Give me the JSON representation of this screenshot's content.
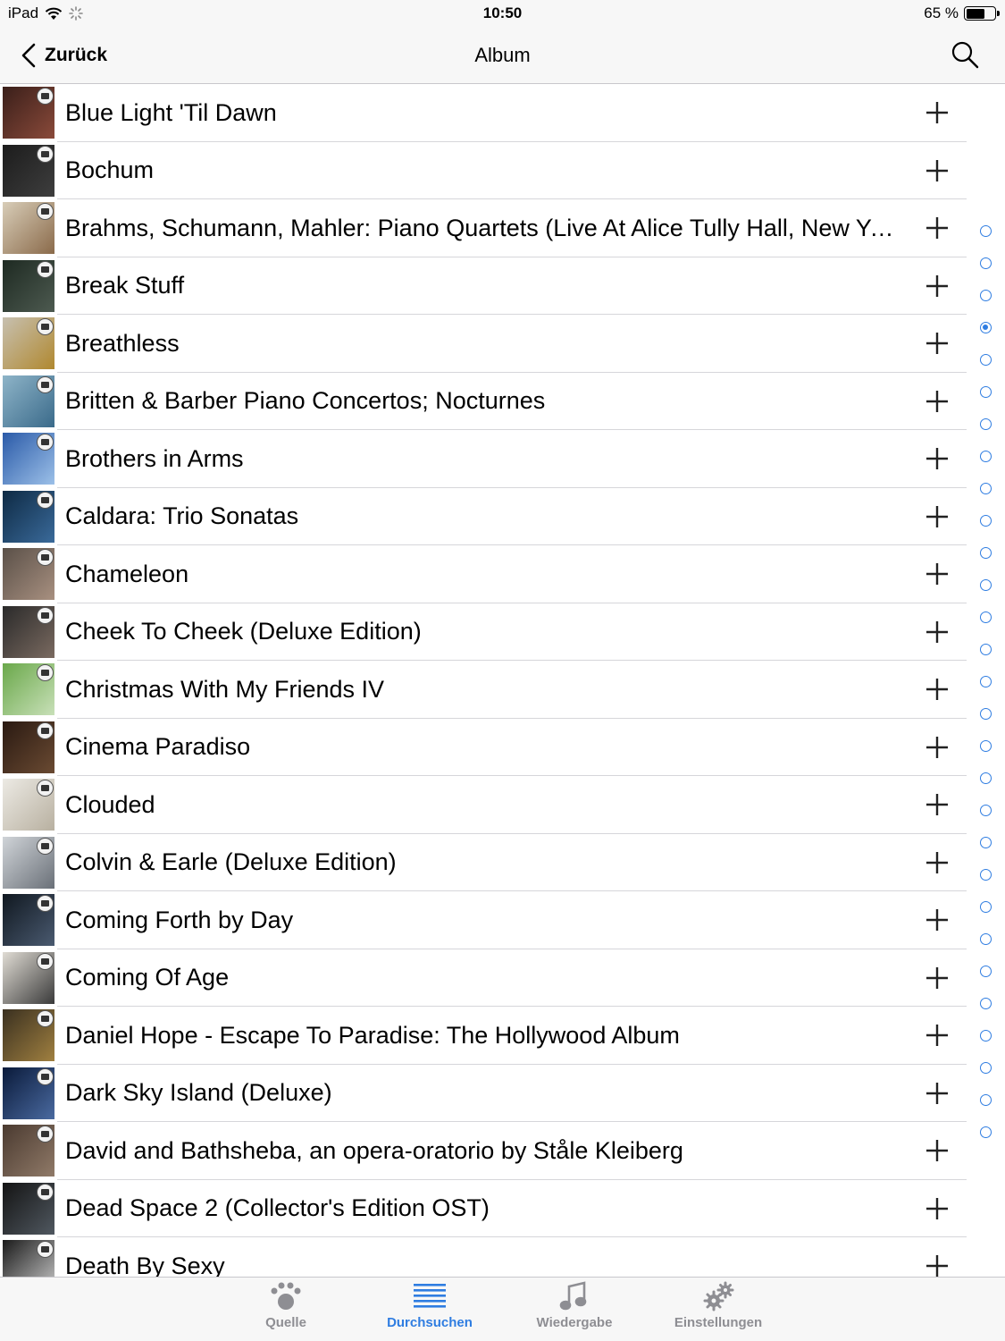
{
  "status_bar": {
    "device": "iPad",
    "time": "10:50",
    "battery_text": "65 %",
    "battery_level": 0.65
  },
  "nav": {
    "back_label": "Zurück",
    "title": "Album"
  },
  "albums": [
    {
      "title": "Blue Light 'Til Dawn",
      "art": [
        "#3a1f1a",
        "#8a4a3a"
      ]
    },
    {
      "title": "Bochum",
      "art": [
        "#1c1c1c",
        "#3e3e3e"
      ]
    },
    {
      "title": "Brahms, Schumann, Mahler: Piano Quartets (Live At Alice Tully Hall, New Yor...",
      "art": [
        "#d8cdb8",
        "#8a6a4a"
      ]
    },
    {
      "title": "Break Stuff",
      "art": [
        "#1e2a22",
        "#4d5a50"
      ]
    },
    {
      "title": "Breathless",
      "art": [
        "#c7c0b0",
        "#b0882f"
      ]
    },
    {
      "title": "Britten & Barber Piano Concertos; Nocturnes",
      "art": [
        "#8eb4c8",
        "#3a6a8a"
      ]
    },
    {
      "title": "Brothers in Arms",
      "art": [
        "#2a5aa8",
        "#9cc0e8"
      ]
    },
    {
      "title": "Caldara: Trio Sonatas",
      "art": [
        "#0e2a44",
        "#3a6a9a"
      ]
    },
    {
      "title": "Chameleon",
      "art": [
        "#5a5048",
        "#a89080"
      ]
    },
    {
      "title": "Cheek To Cheek (Deluxe Edition)",
      "art": [
        "#2a2a2a",
        "#7a6a60"
      ]
    },
    {
      "title": "Christmas With My Friends IV",
      "art": [
        "#6aa84a",
        "#c8e0b8"
      ]
    },
    {
      "title": "Cinema Paradiso",
      "art": [
        "#2a1a12",
        "#6a4a32"
      ]
    },
    {
      "title": "Clouded",
      "art": [
        "#eceae4",
        "#b8b0a0"
      ]
    },
    {
      "title": "Colvin & Earle (Deluxe Edition)",
      "art": [
        "#d0d4d8",
        "#6a7078"
      ]
    },
    {
      "title": "Coming Forth by Day",
      "art": [
        "#101820",
        "#4a5a70"
      ]
    },
    {
      "title": "Coming Of Age",
      "art": [
        "#e0dcd4",
        "#3a3a3a"
      ]
    },
    {
      "title": "Daniel Hope - Escape To Paradise: The Hollywood Album",
      "art": [
        "#3a3020",
        "#a08040"
      ]
    },
    {
      "title": "Dark Sky Island (Deluxe)",
      "art": [
        "#0a1a3a",
        "#4a6aa0"
      ]
    },
    {
      "title": "David and Bathsheba, an opera-oratorio by Ståle Kleiberg",
      "art": [
        "#4a3a30",
        "#907a68"
      ]
    },
    {
      "title": "Dead Space 2 (Collector's Edition OST)",
      "art": [
        "#141414",
        "#505860"
      ]
    },
    {
      "title": "Death By Sexy",
      "art": [
        "#1a1a1a",
        "#c8c8c8"
      ]
    }
  ],
  "index_dots": {
    "count": 29,
    "active": 3
  },
  "tabs": [
    {
      "label": "Quelle",
      "icon": "paw-icon",
      "active": false
    },
    {
      "label": "Durchsuchen",
      "icon": "list-icon",
      "active": true
    },
    {
      "label": "Wiedergabe",
      "icon": "music-note-icon",
      "active": false
    },
    {
      "label": "Einstellungen",
      "icon": "gears-icon",
      "active": false
    }
  ],
  "colors": {
    "accent": "#2f7de1",
    "inactive": "#8e8e93",
    "bar_bg": "#f7f7f7",
    "separator": "#d6d6da"
  }
}
